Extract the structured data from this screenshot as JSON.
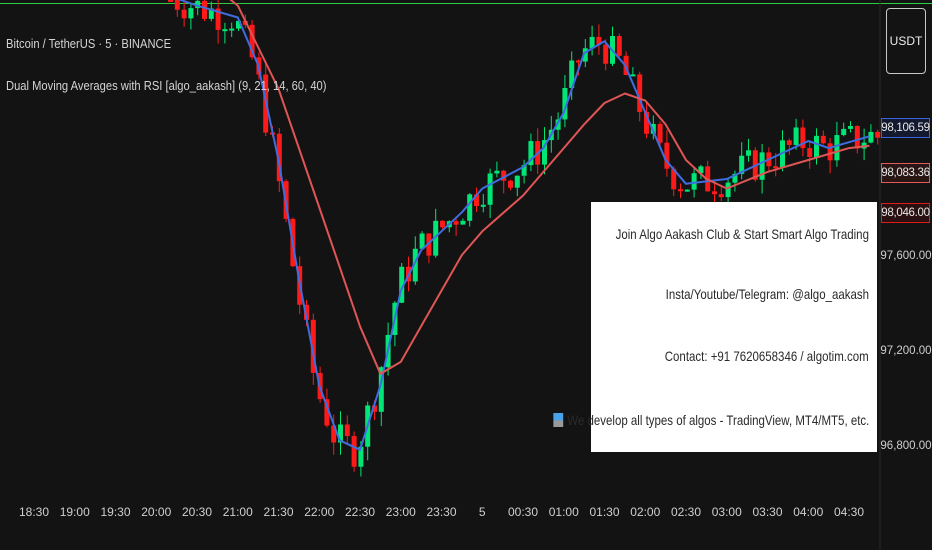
{
  "header": {
    "title": "Bitcoin / TetherUS · 5 · BINANCE",
    "indicator": "Dual Moving Averages with RSI [algo_aakash] (9, 21, 14, 60, 40)"
  },
  "quote_currency": "USDT",
  "price_badges": [
    "98,106.59",
    "98,083.36",
    "98,046.00"
  ],
  "info_box": {
    "lines": [
      "Join Algo Aakash Club & Start Smart Algo Trading",
      "Insta/Youtube/Telegram: @algo_aakash",
      "Contact: +91 7620658346 / algotim.com",
      "We develop all types of algos - TradingView, MT4/MT5, etc."
    ]
  },
  "colors": {
    "background": "#131313",
    "bull": "#00e676",
    "bear": "#ff1a1a",
    "ma_fast": "#3f6ce0",
    "ma_slow": "#e05555",
    "top_line": "#2ecc40"
  },
  "chart_data": {
    "type": "candlestick",
    "symbol": "BTCUSDT",
    "x_ticks": [
      "18:30",
      "19:00",
      "19:30",
      "20:00",
      "20:30",
      "21:00",
      "21:30",
      "22:00",
      "22:30",
      "23:00",
      "23:30",
      "5",
      "00:30",
      "01:00",
      "01:30",
      "02:00",
      "02:30",
      "03:00",
      "03:30",
      "04:00",
      "04:30"
    ],
    "y_ticks": [
      96800,
      97200,
      97600
    ],
    "ylim": [
      96680,
      98700
    ],
    "series": [
      {
        "name": "MA 9",
        "color": "#3f6ce0",
        "values": [
          {
            "t": "20:15",
            "v": 98680
          },
          {
            "t": "20:30",
            "v": 98650
          },
          {
            "t": "21:00",
            "v": 98600
          },
          {
            "t": "21:15",
            "v": 98400
          },
          {
            "t": "21:30",
            "v": 98000
          },
          {
            "t": "21:45",
            "v": 97500
          },
          {
            "t": "22:00",
            "v": 97050
          },
          {
            "t": "22:15",
            "v": 96820
          },
          {
            "t": "22:30",
            "v": 96780
          },
          {
            "t": "22:45",
            "v": 97050
          },
          {
            "t": "23:00",
            "v": 97450
          },
          {
            "t": "23:15",
            "v": 97620
          },
          {
            "t": "23:30",
            "v": 97700
          },
          {
            "t": "23:45",
            "v": 97780
          },
          {
            "t": "00:00",
            "v": 97880
          },
          {
            "t": "00:30",
            "v": 97970
          },
          {
            "t": "00:45",
            "v": 98050
          },
          {
            "t": "01:00",
            "v": 98200
          },
          {
            "t": "01:15",
            "v": 98450
          },
          {
            "t": "01:30",
            "v": 98500
          },
          {
            "t": "01:45",
            "v": 98400
          },
          {
            "t": "02:00",
            "v": 98200
          },
          {
            "t": "02:15",
            "v": 98000
          },
          {
            "t": "02:30",
            "v": 97900
          },
          {
            "t": "03:00",
            "v": 97920
          },
          {
            "t": "03:30",
            "v": 98000
          },
          {
            "t": "04:00",
            "v": 98080
          },
          {
            "t": "04:15",
            "v": 98050
          },
          {
            "t": "04:45",
            "v": 98100
          }
        ]
      },
      {
        "name": "MA 21",
        "color": "#e05555",
        "values": [
          {
            "t": "20:45",
            "v": 98720
          },
          {
            "t": "21:00",
            "v": 98650
          },
          {
            "t": "21:30",
            "v": 98300
          },
          {
            "t": "22:00",
            "v": 97800
          },
          {
            "t": "22:30",
            "v": 97300
          },
          {
            "t": "22:45",
            "v": 97100
          },
          {
            "t": "23:00",
            "v": 97150
          },
          {
            "t": "23:15",
            "v": 97300
          },
          {
            "t": "23:30",
            "v": 97450
          },
          {
            "t": "23:45",
            "v": 97600
          },
          {
            "t": "00:00",
            "v": 97700
          },
          {
            "t": "00:30",
            "v": 97850
          },
          {
            "t": "00:45",
            "v": 97950
          },
          {
            "t": "01:00",
            "v": 98050
          },
          {
            "t": "01:15",
            "v": 98150
          },
          {
            "t": "01:30",
            "v": 98240
          },
          {
            "t": "01:45",
            "v": 98280
          },
          {
            "t": "02:00",
            "v": 98250
          },
          {
            "t": "02:15",
            "v": 98150
          },
          {
            "t": "02:30",
            "v": 98000
          },
          {
            "t": "02:45",
            "v": 97920
          },
          {
            "t": "03:00",
            "v": 97880
          },
          {
            "t": "03:30",
            "v": 97950
          },
          {
            "t": "04:00",
            "v": 98000
          },
          {
            "t": "04:30",
            "v": 98050
          },
          {
            "t": "04:45",
            "v": 98060
          }
        ]
      }
    ]
  }
}
